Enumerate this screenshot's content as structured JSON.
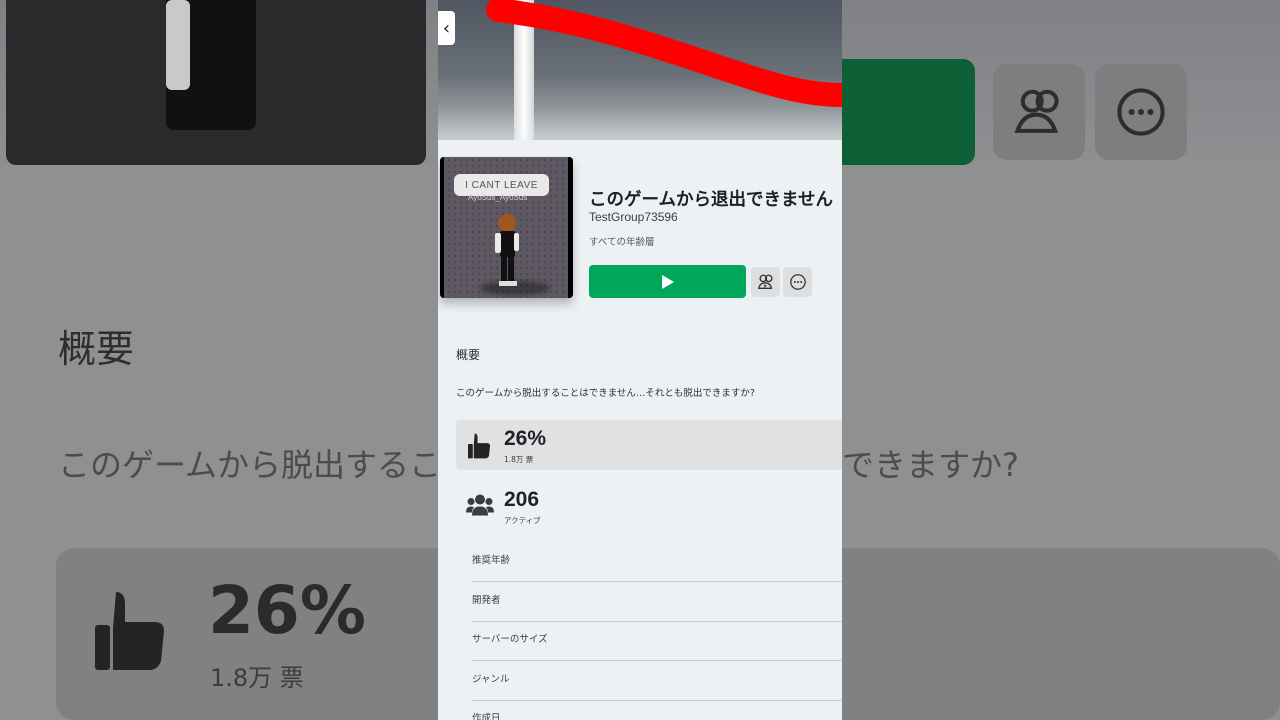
{
  "game": {
    "title": "このゲームから退出できません",
    "creator": "TestGroup73596",
    "age_rating": "すべての年齢層",
    "thumbnail_text": "I CANT LEAVE",
    "thumbnail_subtext": "AyoSus_AyoSus"
  },
  "about": {
    "heading": "概要",
    "description": "このゲームから脱出することはできません…それとも脱出できますか?"
  },
  "stats": {
    "rating_percent": "26%",
    "rating_votes": "1.8万 票",
    "active_count": "206",
    "active_label": "アクティブ"
  },
  "info_rows": [
    "推奨年齢",
    "開発者",
    "サーバーのサイズ",
    "ジャンル",
    "作成日"
  ],
  "background": {
    "heading": "概要",
    "desc_left": "このゲームから脱出すること",
    "desc_right": "できますか?",
    "pct": "26%",
    "votes": "1.8万 票"
  },
  "icons": {
    "back": "chevron-left-icon",
    "play": "play-icon",
    "friends": "friends-icon",
    "more": "more-icon",
    "thumbs_up": "thumbs-up-icon",
    "users": "users-icon"
  },
  "colors": {
    "play_green": "#00a65a",
    "banner_red": "#ff0000"
  }
}
